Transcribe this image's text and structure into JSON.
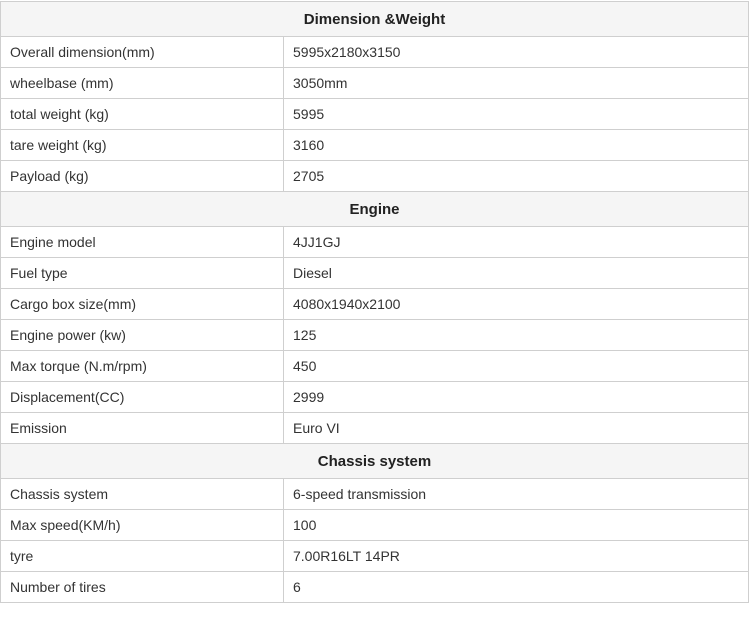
{
  "sections": [
    {
      "title": "Dimension &Weight",
      "rows": [
        {
          "label": "Overall dimension(mm)",
          "value": "5995x2180x3150"
        },
        {
          "label": "wheelbase (mm)",
          "value": "3050mm"
        },
        {
          "label": "total weight (kg)",
          "value": "5995"
        },
        {
          "label": "tare weight (kg)",
          "value": "3160"
        },
        {
          "label": "Payload (kg)",
          "value": "2705"
        }
      ]
    },
    {
      "title": "Engine",
      "rows": [
        {
          "label": "Engine model",
          "value": "4JJ1GJ"
        },
        {
          "label": "Fuel type",
          "value": "Diesel"
        },
        {
          "label": "Cargo box size(mm)",
          "value": "4080x1940x2100"
        },
        {
          "label": "Engine power (kw)",
          "value": "125"
        },
        {
          "label": "Max torque (N.m/rpm)",
          "value": "450"
        },
        {
          "label": "Displacement(CC)",
          "value": "2999"
        },
        {
          "label": "Emission",
          "value": "Euro VI"
        }
      ]
    },
    {
      "title": "Chassis system",
      "rows": [
        {
          "label": "Chassis system",
          "value": "6-speed transmission"
        },
        {
          "label": "Max speed(KM/h)",
          "value": "100"
        },
        {
          "label": "tyre",
          "value": "7.00R16LT 14PR"
        },
        {
          "label": "Number of tires",
          "value": "6"
        }
      ]
    }
  ]
}
